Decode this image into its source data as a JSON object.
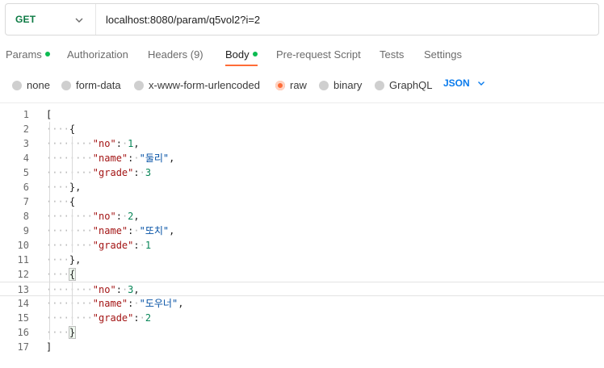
{
  "request": {
    "method": "GET",
    "url": "localhost:8080/param/q5vol2?i=2"
  },
  "tabs": [
    {
      "label": "Params",
      "dot": true
    },
    {
      "label": "Authorization",
      "dot": false
    },
    {
      "label": "Headers (9)",
      "dot": false
    },
    {
      "label": "Body",
      "dot": true,
      "active": true
    },
    {
      "label": "Pre-request Script",
      "dot": false
    },
    {
      "label": "Tests",
      "dot": false
    },
    {
      "label": "Settings",
      "dot": false
    }
  ],
  "body_types": [
    {
      "label": "none",
      "checked": false
    },
    {
      "label": "form-data",
      "checked": false
    },
    {
      "label": "x-www-form-urlencoded",
      "checked": false
    },
    {
      "label": "raw",
      "checked": true
    },
    {
      "label": "binary",
      "checked": false
    },
    {
      "label": "GraphQL",
      "checked": false
    }
  ],
  "raw_format": "JSON",
  "editor": {
    "current_line": 13,
    "lines": [
      {
        "n": "1",
        "indent": 0,
        "text": "["
      },
      {
        "n": "2",
        "indent": 1,
        "text": "{"
      },
      {
        "n": "3",
        "indent": 2,
        "key": "no",
        "value": "1",
        "vtype": "num",
        "comma": true
      },
      {
        "n": "4",
        "indent": 2,
        "key": "name",
        "value": "둘리",
        "vtype": "str",
        "comma": true
      },
      {
        "n": "5",
        "indent": 2,
        "key": "grade",
        "value": "3",
        "vtype": "num",
        "comma": false
      },
      {
        "n": "6",
        "indent": 1,
        "text": "},"
      },
      {
        "n": "7",
        "indent": 1,
        "text": "{"
      },
      {
        "n": "8",
        "indent": 2,
        "key": "no",
        "value": "2",
        "vtype": "num",
        "comma": true
      },
      {
        "n": "9",
        "indent": 2,
        "key": "name",
        "value": "또치",
        "vtype": "str",
        "comma": true
      },
      {
        "n": "10",
        "indent": 2,
        "key": "grade",
        "value": "1",
        "vtype": "num",
        "comma": false
      },
      {
        "n": "11",
        "indent": 1,
        "text": "},"
      },
      {
        "n": "12",
        "indent": 1,
        "text": "{",
        "highlight": true
      },
      {
        "n": "13",
        "indent": 2,
        "key": "no",
        "value": "3",
        "vtype": "num",
        "comma": true
      },
      {
        "n": "14",
        "indent": 2,
        "key": "name",
        "value": "도우너",
        "vtype": "str",
        "comma": true
      },
      {
        "n": "15",
        "indent": 2,
        "key": "grade",
        "value": "2",
        "vtype": "num",
        "comma": false
      },
      {
        "n": "16",
        "indent": 1,
        "text": "}",
        "highlight": true
      },
      {
        "n": "17",
        "indent": 0,
        "text": "]"
      }
    ]
  }
}
